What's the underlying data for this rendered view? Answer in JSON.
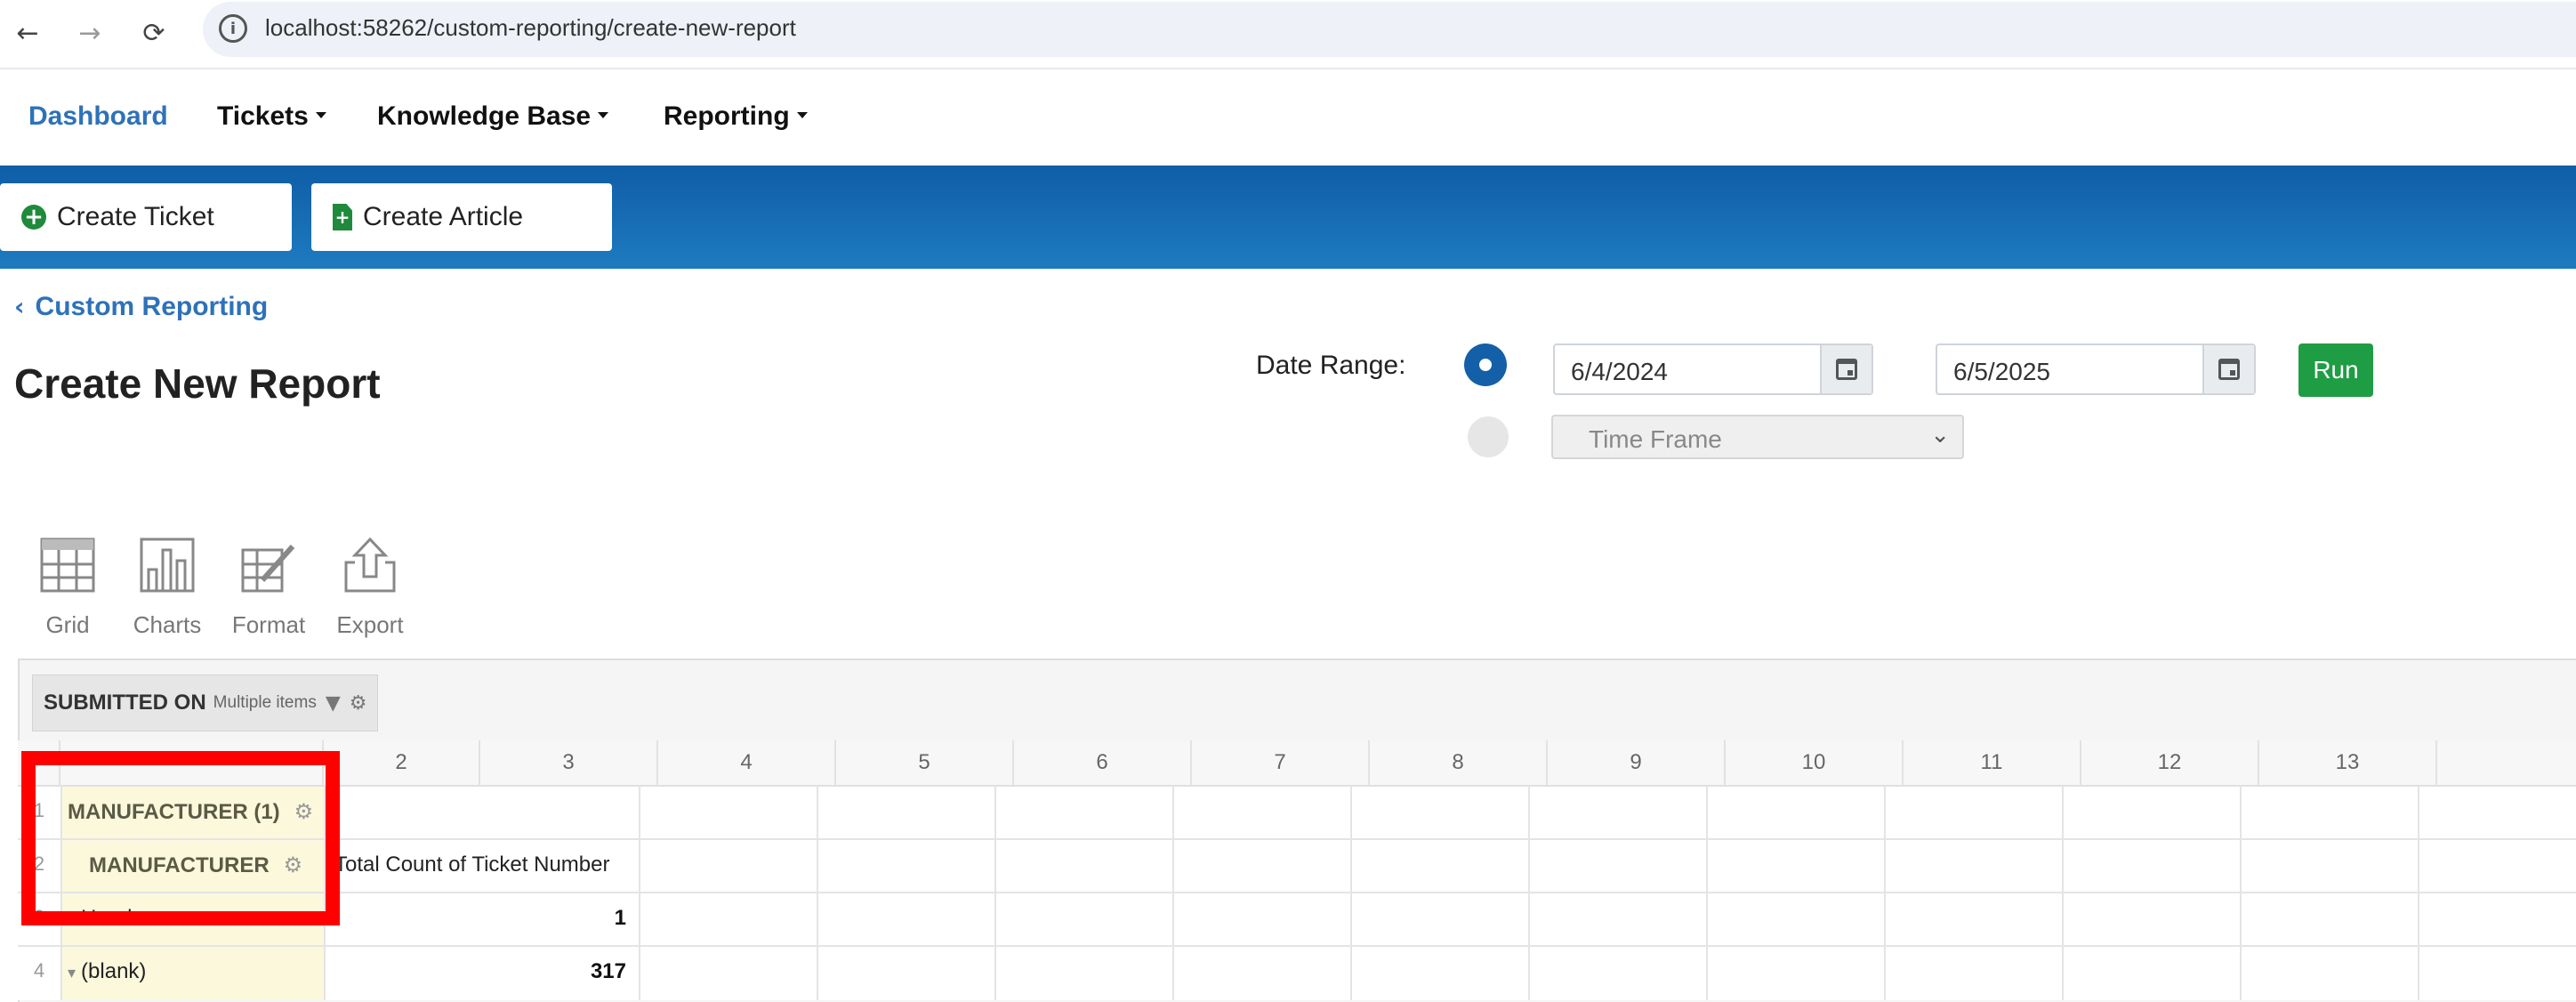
{
  "browser": {
    "url": "localhost:58262/custom-reporting/create-new-report",
    "back_glyph": "←",
    "forward_glyph": "→",
    "reload_glyph": "⟳",
    "info_glyph": "i"
  },
  "top_nav": {
    "items": [
      {
        "label": "Dashboard",
        "active": true,
        "dropdown": false
      },
      {
        "label": "Tickets",
        "active": false,
        "dropdown": true
      },
      {
        "label": "Knowledge Base",
        "active": false,
        "dropdown": true
      },
      {
        "label": "Reporting",
        "active": false,
        "dropdown": true
      }
    ]
  },
  "action_band": {
    "create_ticket": "Create Ticket",
    "create_article": "Create Article"
  },
  "breadcrumb": {
    "back_label": "Custom Reporting",
    "chevron": "‹"
  },
  "page": {
    "title": "Create New Report"
  },
  "date_range": {
    "label": "Date Range:",
    "start": "6/4/2024",
    "end": "6/5/2025",
    "run_label": "Run",
    "timeframe_placeholder": "Time Frame",
    "select_chevron": "⌄",
    "accent_color": "#1460a8",
    "run_color": "#1f9d45"
  },
  "toolbar": {
    "items": [
      {
        "label": "Grid",
        "icon": "grid-icon"
      },
      {
        "label": "Charts",
        "icon": "bar-chart-icon"
      },
      {
        "label": "Format",
        "icon": "format-icon"
      },
      {
        "label": "Export",
        "icon": "export-icon"
      }
    ]
  },
  "pivot": {
    "filter": {
      "name": "SUBMITTED ON",
      "value": "Multiple items",
      "filter_glyph": "▼",
      "gear_glyph": "⚙"
    },
    "column_headers": [
      "2",
      "3",
      "4",
      "5",
      "6",
      "7",
      "8",
      "9",
      "10",
      "11",
      "12",
      "13"
    ],
    "row_numbers": [
      "1",
      "2",
      "3",
      "4"
    ],
    "row_field_group": "MANUFACTURER (1)",
    "row_field": "MANUFACTURER",
    "measure_header": "Total Count of Ticket Number",
    "rows": [
      {
        "label": "Honda",
        "value": "1",
        "toggle": "▸"
      },
      {
        "label": "(blank)",
        "value": "317",
        "toggle": "▾"
      }
    ],
    "gear_glyph": "⚙"
  },
  "annotation": {
    "highlight_color": "#ff0000"
  }
}
